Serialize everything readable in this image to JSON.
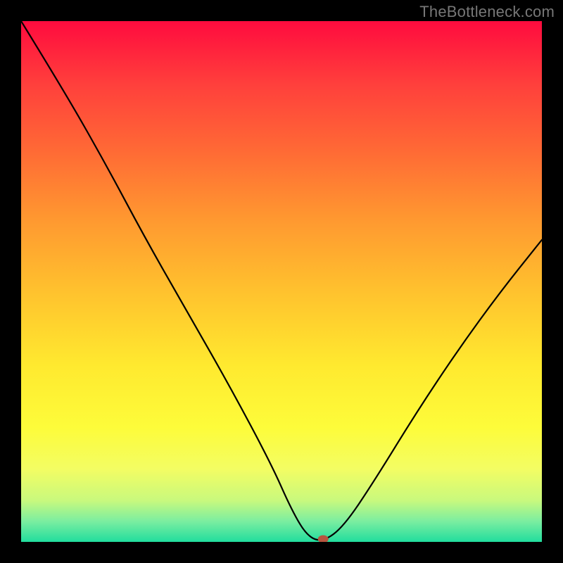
{
  "watermark": "TheBottleneck.com",
  "chart_data": {
    "type": "line",
    "title": "",
    "xlabel": "",
    "ylabel": "",
    "xlim": [
      0,
      100
    ],
    "ylim": [
      0,
      100
    ],
    "grid": false,
    "legend": false,
    "series": [
      {
        "name": "curve",
        "x": [
          0,
          8,
          16,
          24,
          32,
          40,
          48,
          52,
          55,
          58,
          62,
          68,
          76,
          84,
          92,
          100
        ],
        "values": [
          100,
          87,
          73,
          58,
          44,
          30,
          15,
          6,
          1,
          0,
          3,
          12,
          25,
          37,
          48,
          58
        ]
      }
    ],
    "marker": {
      "x": 58,
      "y": 0
    },
    "background_gradient": {
      "top_color": "#ff0b3e",
      "bottom_color": "#21dd9e"
    }
  }
}
